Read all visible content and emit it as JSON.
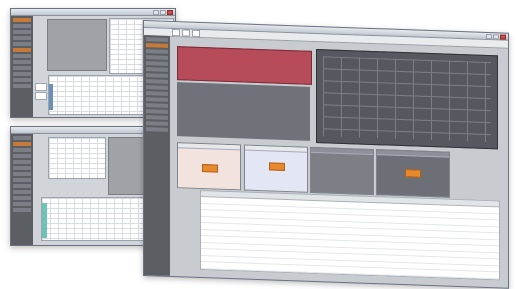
{
  "colors": {
    "alarm": "#b64b59",
    "accent_orange": "#e8892b",
    "chart_bg": "#55595f",
    "sidebar": "#5b5e63"
  },
  "main_window": {
    "title": "",
    "tabs": [
      "",
      "",
      ""
    ],
    "table_title": "",
    "rows": [
      [
        "",
        "",
        "",
        "",
        ""
      ],
      [
        "",
        "",
        "",
        "",
        ""
      ],
      [
        "",
        "",
        "",
        "",
        ""
      ],
      [
        "",
        "",
        "",
        "",
        ""
      ],
      [
        "",
        "",
        "",
        "",
        ""
      ],
      [
        "",
        "",
        "",
        "",
        ""
      ],
      [
        "",
        "",
        "",
        "",
        ""
      ],
      [
        "",
        "",
        "",
        "",
        ""
      ],
      [
        "",
        "",
        "",
        "",
        ""
      ],
      [
        "",
        "",
        "",
        "",
        ""
      ],
      [
        "",
        "",
        "",
        "",
        ""
      ],
      [
        "",
        "",
        "",
        "",
        ""
      ]
    ]
  },
  "top_window": {
    "title": ""
  },
  "bottom_window": {
    "title": ""
  },
  "icons": [
    "minimize-icon",
    "maximize-icon",
    "close-icon"
  ]
}
